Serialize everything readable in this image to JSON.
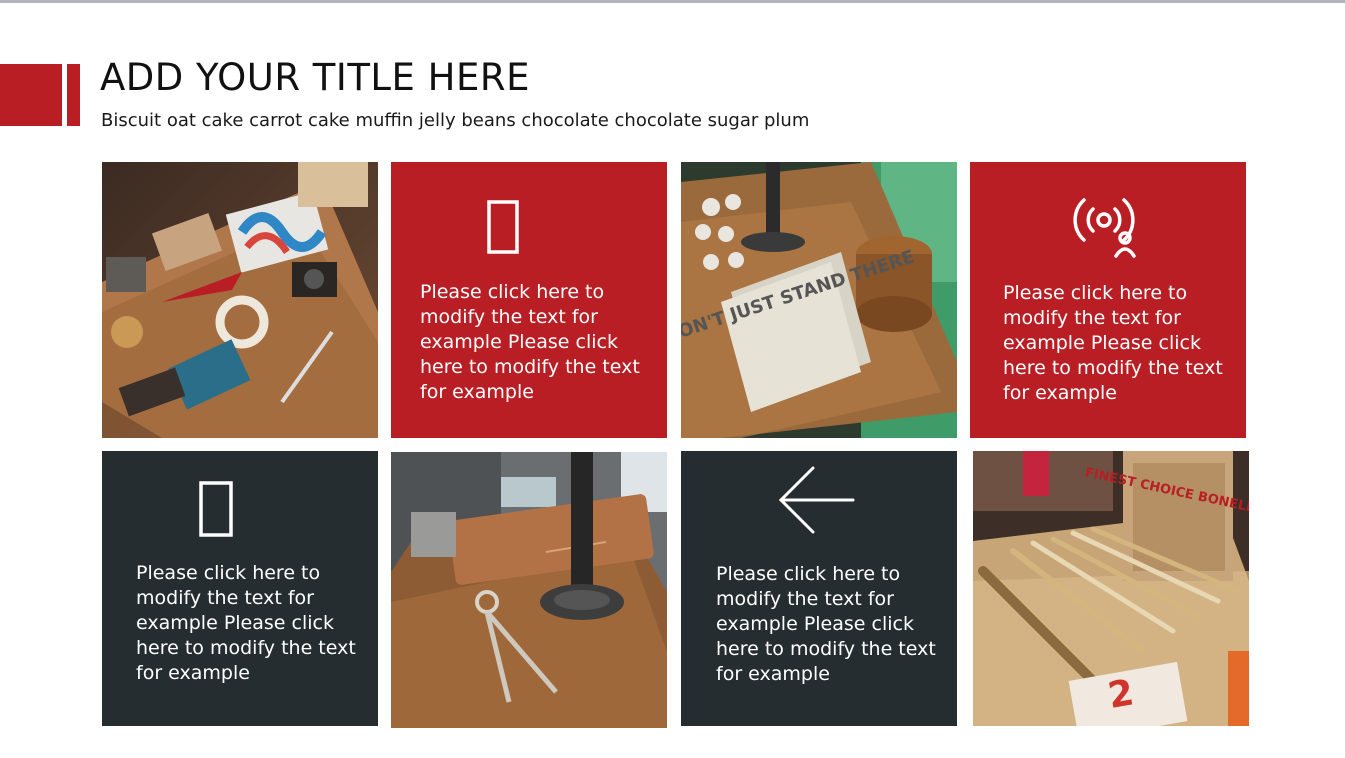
{
  "header": {
    "title": "ADD YOUR TITLE HERE",
    "subtitle": "Biscuit oat cake carrot cake muffin jelly beans chocolate chocolate sugar plum"
  },
  "tiles": [
    {
      "kind": "photo",
      "name": "desk-flatlay-photo"
    },
    {
      "kind": "text",
      "icon": "rectangle-icon",
      "text": "Please click here to modify the text for example Please click here to modify the text for example"
    },
    {
      "kind": "photo",
      "name": "notebook-desk-photo"
    },
    {
      "kind": "text",
      "icon": "broadcast-user-icon",
      "text": "Please click here to modify the text for example Please click here to modify the text for example"
    },
    {
      "kind": "text",
      "icon": "rectangle-icon",
      "text": "Please click here to modify the text for example Please click here to modify the text for example"
    },
    {
      "kind": "photo",
      "name": "compass-wallet-photo"
    },
    {
      "kind": "text",
      "icon": "arrow-left-icon",
      "text": "Please click here to modify the text for example Please click here to modify the text for example"
    },
    {
      "kind": "photo",
      "name": "pencils-shelf-photo"
    }
  ],
  "photo_signs": {
    "notebook": "DON'T JUST STAND THERE",
    "box": "FINEST CHOICE BONELESS"
  },
  "colors": {
    "accent_red": "#b81e24",
    "dark_slate": "#252d31",
    "text_white": "#ffffff"
  }
}
